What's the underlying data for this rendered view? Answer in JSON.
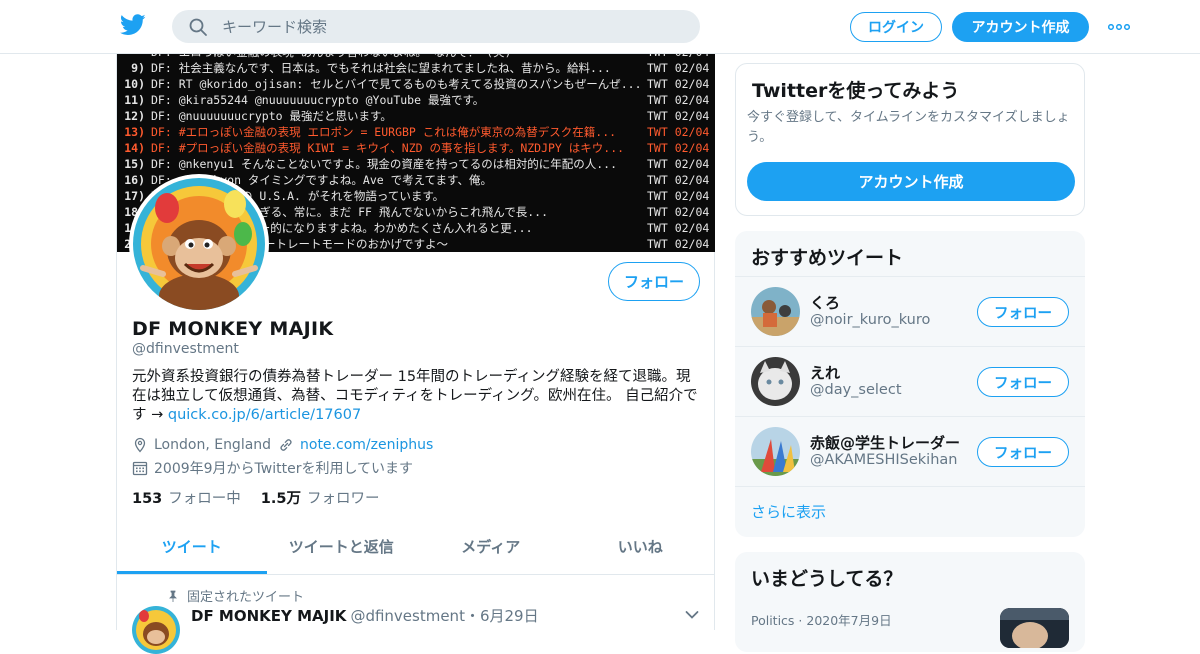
{
  "header": {
    "search_placeholder": "キーワード検索",
    "login_label": "ログイン",
    "signup_label": "アカウント作成"
  },
  "banner": {
    "lines": [
      {
        "num": "",
        "text": "DF: エロっぽい金融の表現 あんまり言わないよね。 なんで？ (笑)",
        "src": "TWT 02/04",
        "red": false
      },
      {
        "num": "9)",
        "text": "DF: 社会主義なんです、日本は。でもそれは社会に望まれてましたね、昔から。給料...",
        "src": "TWT 02/04",
        "red": false
      },
      {
        "num": "10)",
        "text": "DF: RT @korido_ojisan: セルとバイで見てるものも考えてる投資のスパンもぜーんぜ...",
        "src": "TWT 02/04",
        "red": false
      },
      {
        "num": "11)",
        "text": "DF: @kira55244 @nuuuuuuucrypto @YouTube 最強です。",
        "src": "TWT 02/04",
        "red": false
      },
      {
        "num": "12)",
        "text": "DF: @nuuuuuuucrypto 最強だと思います。",
        "src": "TWT 02/04",
        "red": false
      },
      {
        "num": "13)",
        "text": "DF: #エロっぽい金融の表現 エロポン = EURGBP これは俺が東京の為替デスク在籍...",
        "src": "TWT 02/04",
        "red": true
      },
      {
        "num": "14)",
        "text": "DF: #プロっぽい金融の表現 KIWI = キウイ、NZD の事を指します。NZDJPY はキウ...",
        "src": "TWT 02/04",
        "red": true
      },
      {
        "num": "15)",
        "text": "DF: @nkenyu1 そんなことないですよ。現金の資産を持ってるのは相対的に年配の人...",
        "src": "TWT 02/04",
        "red": false
      },
      {
        "num": "16)",
        "text": "DF: @kazchyon タイミングですよね。Ave で考えてます、俺。",
        "src": "TWT 02/04",
        "red": false
      },
      {
        "num": "17)",
        "text": "DF: The Pump の U.S.A. がそれを物語っています。",
        "src": "TWT 02/04",
        "red": false
      },
      {
        "num": "18)",
        "text": "DF: ショートが多すぎる、常に。まだ FF 飛んでないからこれ飛んで長...",
        "src": "TWT 02/04",
        "red": false
      },
      {
        "num": "19)",
        "text": "DF: クラムチャウダー的になりますよね。わかめたくさん入れると更...",
        "src": "TWT 02/04",
        "red": false
      },
      {
        "num": "20)",
        "text": "DF: iPhone X のポートレートモードのおかげですよ～",
        "src": "TWT 02/04",
        "red": false
      }
    ]
  },
  "profile": {
    "follow_label": "フォロー",
    "name": "DF MONKEY MAJIK",
    "handle": "@dfinvestment",
    "bio": "元外資系投資銀行の債券為替トレーダー 15年間のトレーディング経験を経て退職。現在は独立して仮想通貨、為替、コモディティをトレーディング。欧州在住。 自己紹介です →",
    "bio_link": "quick.co.jp/6/article/17607",
    "location": "London, England",
    "website": "note.com/zeniphus",
    "joined": "2009年9月からTwitterを利用しています",
    "following_count": "153",
    "following_label": "フォロー中",
    "followers_count": "1.5万",
    "followers_label": "フォロワー"
  },
  "tabs": [
    "ツイート",
    "ツイートと返信",
    "メディア",
    "いいね"
  ],
  "pinned": {
    "label": "固定されたツイート",
    "name": "DF MONKEY MAJIK",
    "handle": "@dfinvestment",
    "date": "・6月29日"
  },
  "signup_card": {
    "title": "Twitterを使ってみよう",
    "text": "今すぐ登録して、タイムラインをカスタマイズしましょう。",
    "button": "アカウント作成"
  },
  "recommendations": {
    "title": "おすすめツイート",
    "follow_label": "フォロー",
    "show_more": "さらに表示",
    "users": [
      {
        "name": "くろ",
        "handle": "@noir_kuro_kuro"
      },
      {
        "name": "えれ",
        "handle": "@day_select"
      },
      {
        "name": "赤飯@学生トレーダー",
        "handle": "@AKAMESHISekihan"
      }
    ]
  },
  "trends": {
    "title": "いまどうしてる？",
    "meta": "Politics · 2020年7月9日"
  },
  "colors": {
    "accent": "#1da1f2",
    "banner_red": "#ff5a2e"
  }
}
